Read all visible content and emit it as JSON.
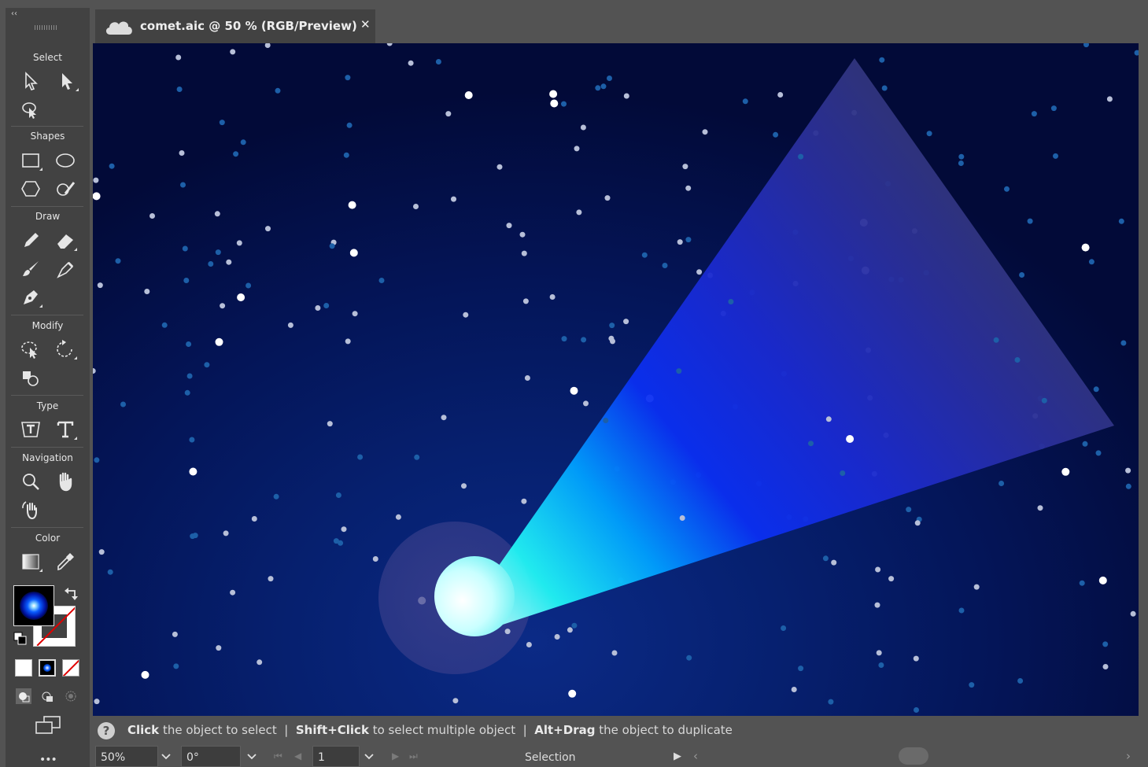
{
  "document": {
    "tab_title": "comet.aic @ 50 % (RGB/Preview)",
    "close_glyph": "✕"
  },
  "toolbar": {
    "collapse_glyph": "‹‹",
    "sections": {
      "select": "Select",
      "shapes": "Shapes",
      "draw": "Draw",
      "modify": "Modify",
      "type": "Type",
      "navigation": "Navigation",
      "color": "Color"
    },
    "more_glyph": "•••"
  },
  "hint": {
    "q": "?",
    "p1_bold": "Click",
    "p1_rest": " the object to select",
    "p2_bold": "Shift+Click",
    "p2_rest": " to select multiple object",
    "p3_bold": "Alt+Drag",
    "p3_rest": " the object to duplicate",
    "sep": "|"
  },
  "status": {
    "zoom": "50%",
    "rotation": "0°",
    "page": "1",
    "mode": "Selection"
  },
  "colors": {
    "fill": "#0a5cff",
    "stroke": "none",
    "canvas_bg": "#041558",
    "ui_panel": "#424242"
  }
}
